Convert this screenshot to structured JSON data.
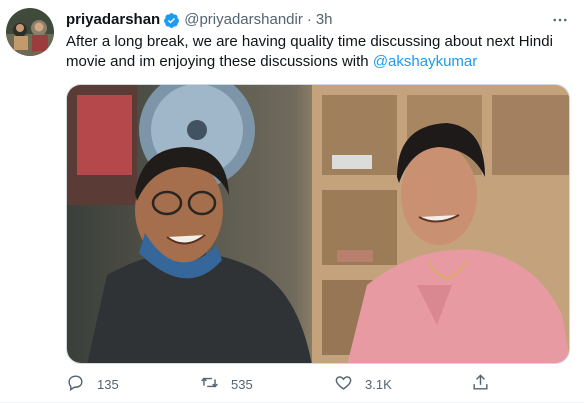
{
  "tweet": {
    "display_name": "priyadarshan",
    "handle": "@priyadarshandir",
    "separator": "·",
    "time": "3h",
    "text_before_mention": "After a long break, we are having quality time discussing about next Hindi movie and im enjoying these discussions with ",
    "mention": "@akshaykumar"
  },
  "actions": {
    "reply_count": "135",
    "retweet_count": "535",
    "like_count": "3.1K"
  },
  "colors": {
    "accent": "#1d9bf0",
    "muted_text": "#536471",
    "main_text": "#0f1419",
    "shirt_pink": "#e89aa3"
  },
  "icons": {
    "verified": "verified-badge-icon",
    "more": "more-dots-icon",
    "reply": "reply-icon",
    "retweet": "retweet-icon",
    "like": "heart-icon",
    "share": "share-icon"
  }
}
